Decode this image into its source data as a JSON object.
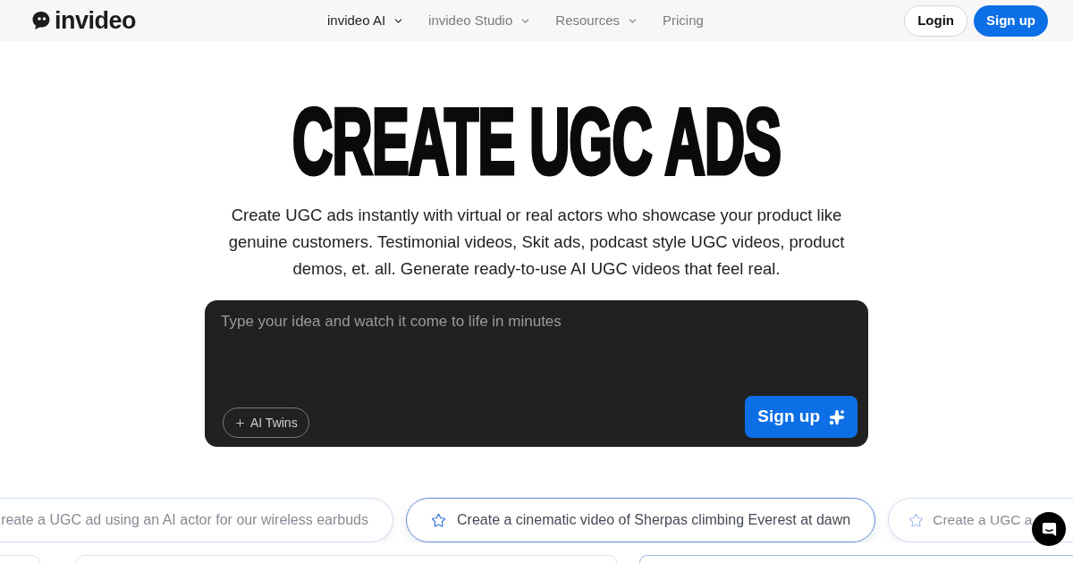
{
  "header": {
    "logo": {
      "text": "invideo"
    },
    "nav": [
      {
        "label": "invideo AI",
        "dropdown": true,
        "selected": true
      },
      {
        "label": "invideo Studio",
        "dropdown": true,
        "selected": false
      },
      {
        "label": "Resources",
        "dropdown": true,
        "selected": false
      },
      {
        "label": "Pricing",
        "dropdown": false,
        "selected": false
      }
    ],
    "buttons": [
      {
        "kind": "outline",
        "label": "Login"
      },
      {
        "kind": "primary",
        "label": "Sign up"
      }
    ]
  },
  "hero": {
    "title": "CREATE UGC ADS",
    "description": "Create UGC ads instantly with virtual or real actors who showcase your product like genuine customers. Testimonial videos, Skit ads, podcast style UGC videos, product demos, et. all. Generate ready-to-use AI UGC videos that feel real."
  },
  "prompt": {
    "placeholder": "Type your idea and watch it come to life in minutes",
    "chip": "AI Twins",
    "submit": "Sign up"
  },
  "suggestions": [
    {
      "text": "reate a UGC ad using an AI actor for our wireless earbuds",
      "star": false,
      "selected": false
    },
    {
      "text": "Create a cinematic video of Sherpas climbing Everest at dawn",
      "star": true,
      "selected": true
    },
    {
      "text": "Create a UGC a",
      "star": true,
      "selected": false
    }
  ]
}
